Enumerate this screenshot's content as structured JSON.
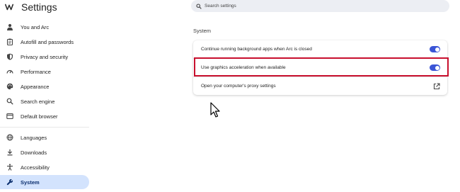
{
  "app": {
    "title": "Settings"
  },
  "sidebar": {
    "items": [
      {
        "label": "You and Arc",
        "icon": "person-icon"
      },
      {
        "label": "Autofill and passwords",
        "icon": "clipboard-icon"
      },
      {
        "label": "Privacy and security",
        "icon": "shield-icon"
      },
      {
        "label": "Performance",
        "icon": "speedometer-icon"
      },
      {
        "label": "Appearance",
        "icon": "palette-icon"
      },
      {
        "label": "Search engine",
        "icon": "search-icon"
      },
      {
        "label": "Default browser",
        "icon": "browser-icon"
      },
      {
        "label": "Languages",
        "icon": "globe-icon"
      },
      {
        "label": "Downloads",
        "icon": "download-icon"
      },
      {
        "label": "Accessibility",
        "icon": "accessibility-icon"
      },
      {
        "label": "System",
        "icon": "wrench-icon",
        "active": true
      }
    ]
  },
  "search": {
    "placeholder": "Search settings"
  },
  "system": {
    "title": "System",
    "rows": [
      {
        "label": "Continue running background apps when Arc is closed",
        "control": "toggle",
        "on": true
      },
      {
        "label": "Use graphics acceleration when available",
        "control": "toggle",
        "on": true,
        "highlighted": true
      },
      {
        "label": "Open your computer's proxy settings",
        "control": "external-link-icon"
      }
    ]
  },
  "colors": {
    "accent": "#3b55d6",
    "active_bg": "#d3e3fd",
    "highlight": "#c8102e"
  }
}
